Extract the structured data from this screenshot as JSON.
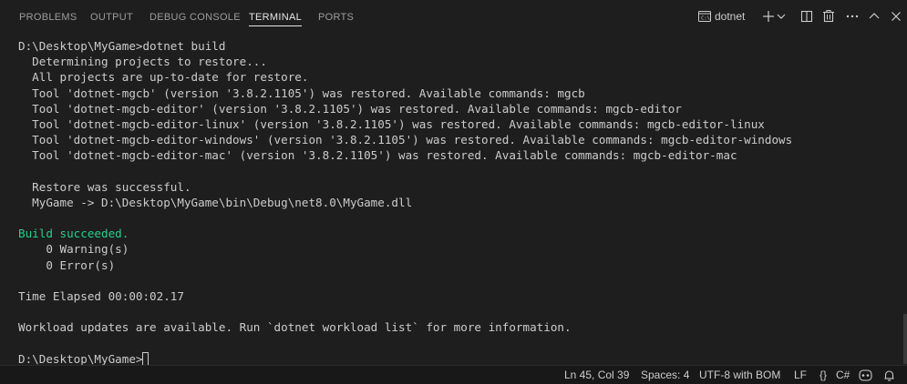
{
  "tabs": [
    {
      "label": "PROBLEMS"
    },
    {
      "label": "OUTPUT"
    },
    {
      "label": "DEBUG CONSOLE"
    },
    {
      "label": "TERMINAL",
      "active": true
    },
    {
      "label": "PORTS"
    }
  ],
  "toolbar": {
    "terminal_name": "dotnet",
    "icons": [
      "terminal-icon",
      "plus-icon",
      "chevron-down-icon",
      "split-icon",
      "trash-icon",
      "more-icon",
      "chevron-up-icon",
      "close-icon"
    ]
  },
  "terminal": {
    "lines": [
      "D:\\Desktop\\MyGame>dotnet build",
      "  Determining projects to restore...",
      "  All projects are up-to-date for restore.",
      "  Tool 'dotnet-mgcb' (version '3.8.2.1105') was restored. Available commands: mgcb",
      "  Tool 'dotnet-mgcb-editor' (version '3.8.2.1105') was restored. Available commands: mgcb-editor",
      "  Tool 'dotnet-mgcb-editor-linux' (version '3.8.2.1105') was restored. Available commands: mgcb-editor-linux",
      "  Tool 'dotnet-mgcb-editor-windows' (version '3.8.2.1105') was restored. Available commands: mgcb-editor-windows",
      "  Tool 'dotnet-mgcb-editor-mac' (version '3.8.2.1105') was restored. Available commands: mgcb-editor-mac",
      "",
      "  Restore was successful.",
      "  MyGame -> D:\\Desktop\\MyGame\\bin\\Debug\\net8.0\\MyGame.dll",
      "",
      "Build succeeded.",
      "    0 Warning(s)",
      "    0 Error(s)",
      "",
      "Time Elapsed 00:00:02.17",
      "",
      "Workload updates are available. Run `dotnet workload list` for more information.",
      "",
      "D:\\Desktop\\MyGame>"
    ],
    "success_color": "#23d18b",
    "text_color": "#cccccc",
    "background": "#1e1e1e"
  },
  "statusbar": {
    "position": "Ln 45, Col 39",
    "spaces": "Spaces: 4",
    "encoding": "UTF-8 with BOM",
    "eol": "LF",
    "language_brackets": "{}",
    "language": "C#",
    "icons": [
      "braces-icon",
      "copilot-icon",
      "notifications-icon"
    ]
  }
}
